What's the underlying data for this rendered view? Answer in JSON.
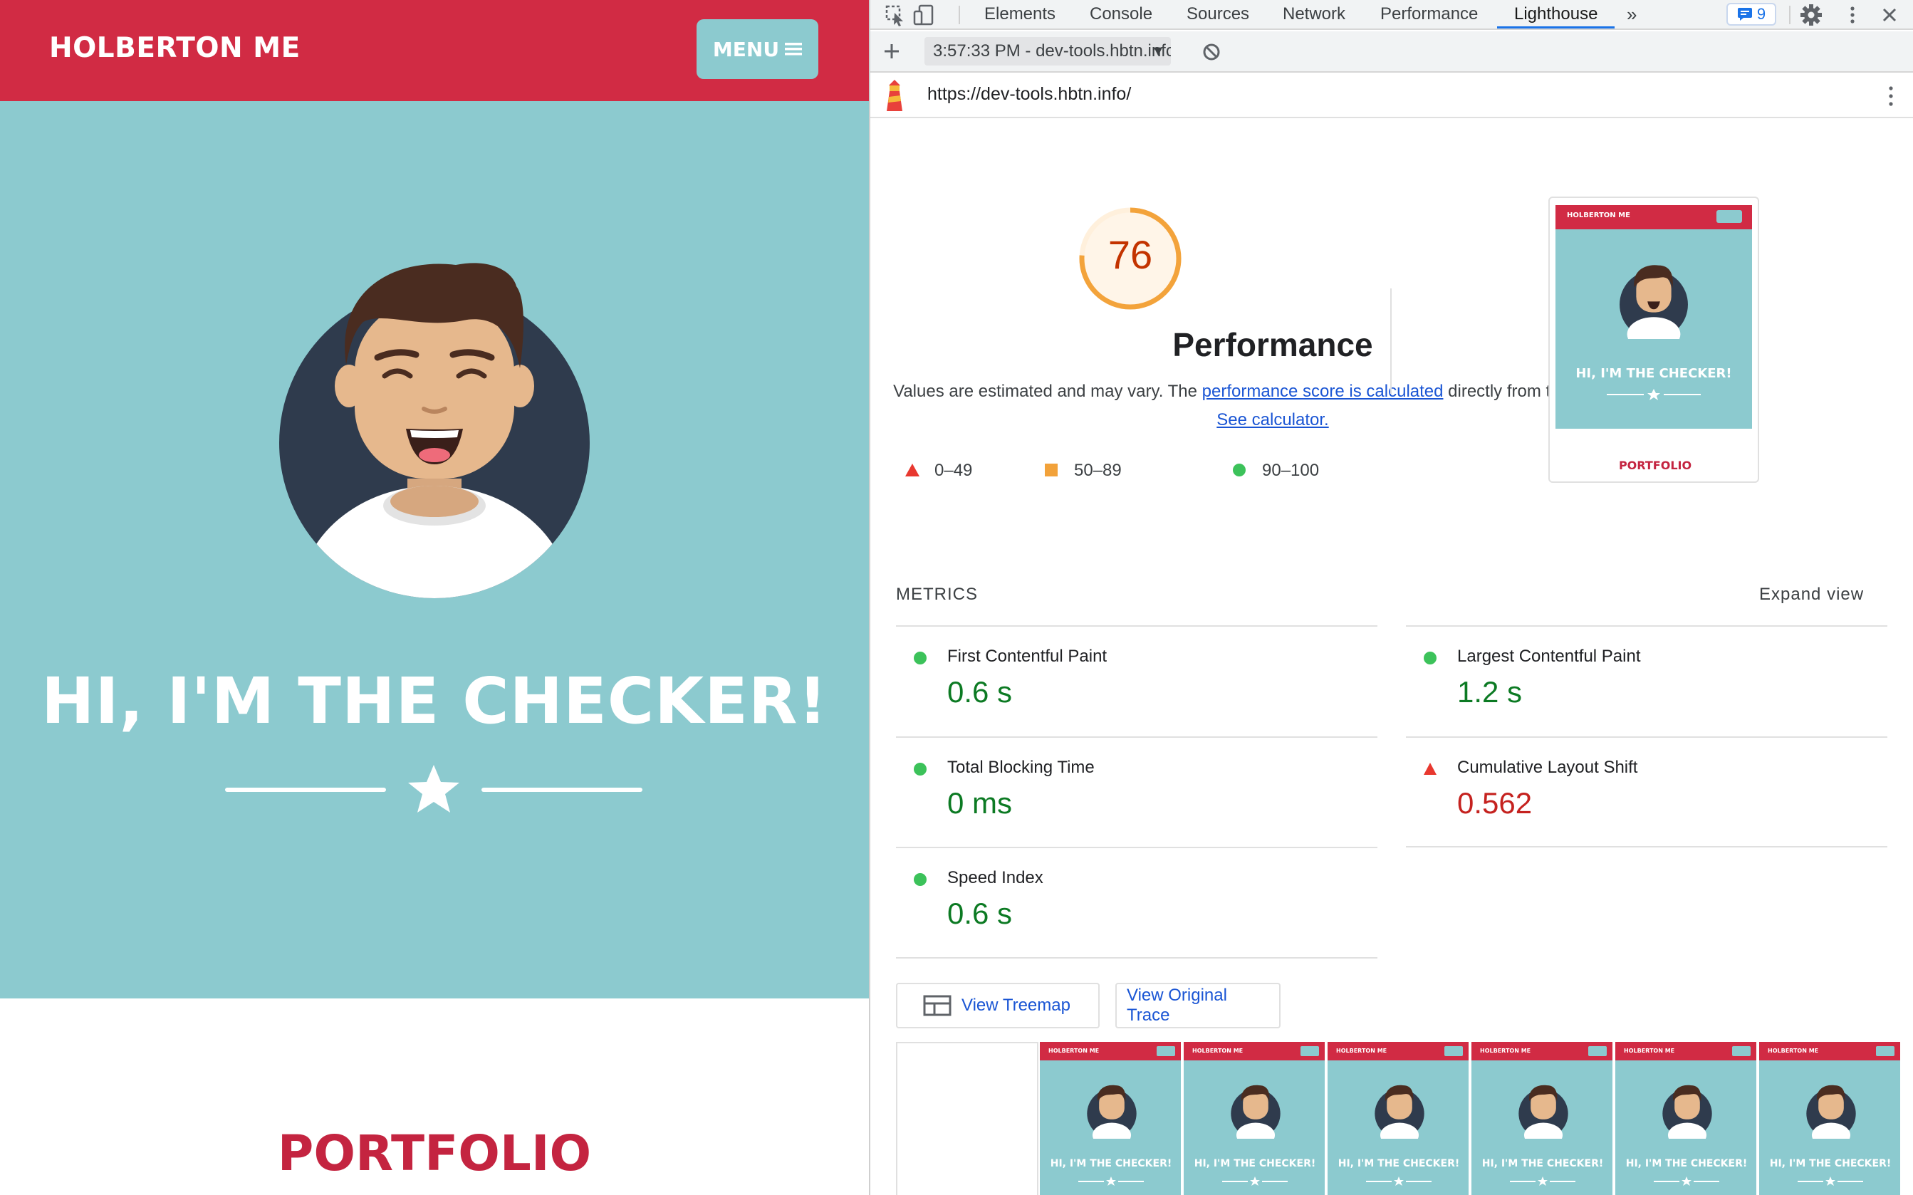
{
  "site": {
    "brand": "HOLBERTON ME",
    "menu_label": "MENU",
    "hero_title": "HI, I'M THE CHECKER!",
    "section_title": "PORTFOLIO",
    "colors": {
      "header": "#d12b44",
      "hero": "#8ccacf",
      "portfolio": "#c42440"
    }
  },
  "devtools": {
    "tabs": [
      "Elements",
      "Console",
      "Sources",
      "Network",
      "Performance",
      "Lighthouse"
    ],
    "active_tab": "Lighthouse",
    "issues_count": "9",
    "report_selector": "3:57:33 PM - dev-tools.hbtn.info",
    "url": "https://dev-tools.hbtn.info/"
  },
  "lighthouse": {
    "score": "76",
    "score_value": 76,
    "category": "Performance",
    "desc_prefix": "Values are estimated and may vary. The ",
    "desc_link1": "performance score is calculated",
    "desc_middle": " directly from these metrics. ",
    "desc_link2": "See calculator.",
    "legend": [
      {
        "range": "0–49",
        "shape": "triangle",
        "color": "#e8382f"
      },
      {
        "range": "50–89",
        "shape": "square",
        "color": "#f2a23a"
      },
      {
        "range": "90–100",
        "shape": "circle",
        "color": "#3cc25a"
      }
    ],
    "thumbnail": {
      "brand": "HOLBERTON ME",
      "title": "HI, I'M THE CHECKER!",
      "section": "PORTFOLIO"
    },
    "metrics_label": "METRICS",
    "expand_label": "Expand view",
    "metrics": [
      {
        "label": "First Contentful Paint",
        "value": "0.6 s",
        "status": "good"
      },
      {
        "label": "Largest Contentful Paint",
        "value": "1.2 s",
        "status": "good"
      },
      {
        "label": "Total Blocking Time",
        "value": "0 ms",
        "status": "good"
      },
      {
        "label": "Cumulative Layout Shift",
        "value": "0.562",
        "status": "bad"
      },
      {
        "label": "Speed Index",
        "value": "0.6 s",
        "status": "good"
      }
    ],
    "view_treemap": "View Treemap",
    "view_trace": "View Original Trace",
    "filmstrip_frames": [
      {
        "brand": "HOLBERTON ME",
        "title": "HI, I'M THE CHECKER!"
      },
      {
        "brand": "HOLBERTON ME",
        "title": "HI, I'M THE CHECKER!"
      },
      {
        "brand": "HOLBERTON ME",
        "title": "HI, I'M THE CHECKER!"
      },
      {
        "brand": "HOLBERTON ME",
        "title": "HI, I'M THE CHECKER!"
      },
      {
        "brand": "HOLBERTON ME",
        "title": "HI, I'M THE CHECKER!"
      },
      {
        "brand": "HOLBERTON ME",
        "title": "HI, I'M THE CHECKER!"
      }
    ]
  }
}
